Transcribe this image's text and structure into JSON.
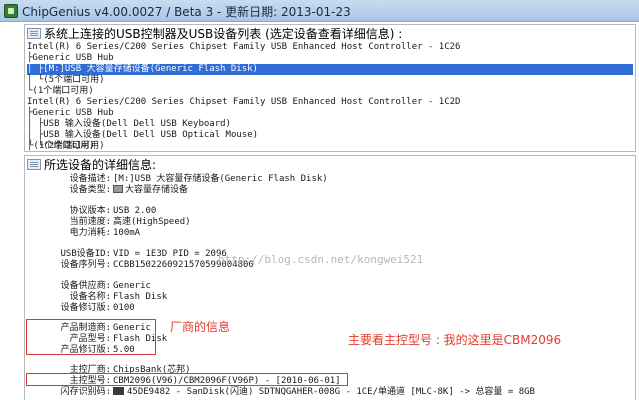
{
  "window": {
    "title": "ChipGenius v4.00.0027 / Beta 3 - 更新日期: 2013-01-23"
  },
  "device_list": {
    "header": "系统上连接的USB控制器及USB设备列表 (选定设备查看详细信息) :",
    "lines": [
      "Intel(R) 6 Series/C200 Series Chipset Family USB Enhanced Host Controller - 1C26",
      "├Generic USB Hub",
      "│ ├[M:]USB 大容量存储设备(Generic Flash Disk)",
      "│ └(5个端口可用)",
      "└(1个端口可用)",
      "Intel(R) 6 Series/C200 Series Chipset Family USB Enhanced Host Controller - 1C2D",
      "├Generic USB Hub",
      "│ ├USB 输入设备(Dell Dell USB Keyboard)",
      "│ ├USB 输入设备(Dell Dell USB Optical Mouse)",
      "│ └(2个端口可用)",
      "└(1个端口可用)"
    ]
  },
  "details": {
    "header": "所选设备的详细信息:",
    "rows": [
      {
        "label": "设备描述:",
        "value": "[M:]USB 大容量存储设备(Generic Flash Disk)"
      },
      {
        "label": "设备类型:",
        "value": "大容量存储设备"
      },
      {
        "label": "协议版本:",
        "value": "USB 2.00"
      },
      {
        "label": "当前速度:",
        "value": "高速(HighSpeed)"
      },
      {
        "label": "电力消耗:",
        "value": "100mA"
      },
      {
        "label": "USB设备ID:",
        "value": "VID = 1E3D PID = 2096"
      },
      {
        "label": "设备序列号:",
        "value": "CCBB1502260921570599004800"
      },
      {
        "label": "设备供应商:",
        "value": "Generic"
      },
      {
        "label": "设备名称:",
        "value": "Flash Disk"
      },
      {
        "label": "设备修订版:",
        "value": "0100"
      },
      {
        "label": "产品制造商:",
        "value": "Generic"
      },
      {
        "label": "产品型号:",
        "value": "Flash Disk"
      },
      {
        "label": "产品修订版:",
        "value": "5.00"
      },
      {
        "label": "主控厂商:",
        "value": "ChipsBank(芯邦)"
      },
      {
        "label": "主控型号:",
        "value": "CBM2096(V96)/CBM2096F(V96P) - [2010-06-01]"
      },
      {
        "label": "闪存识别码:",
        "value": "45DE9482 - SanDisk(闪迪) SDTNQGAHER-008G - 1CE/单通道 [MLC-8K] -> 总容量 = 8GB"
      }
    ]
  },
  "watermark": "http://blog.csdn.net/kongwei521",
  "annotations": {
    "vendor_info": "厂商的信息",
    "controller_note": "主要看主控型号 : 我的这里是CBM2096"
  },
  "colors": {
    "selection": "#2f6cd6",
    "annotation": "#e23b2a"
  }
}
